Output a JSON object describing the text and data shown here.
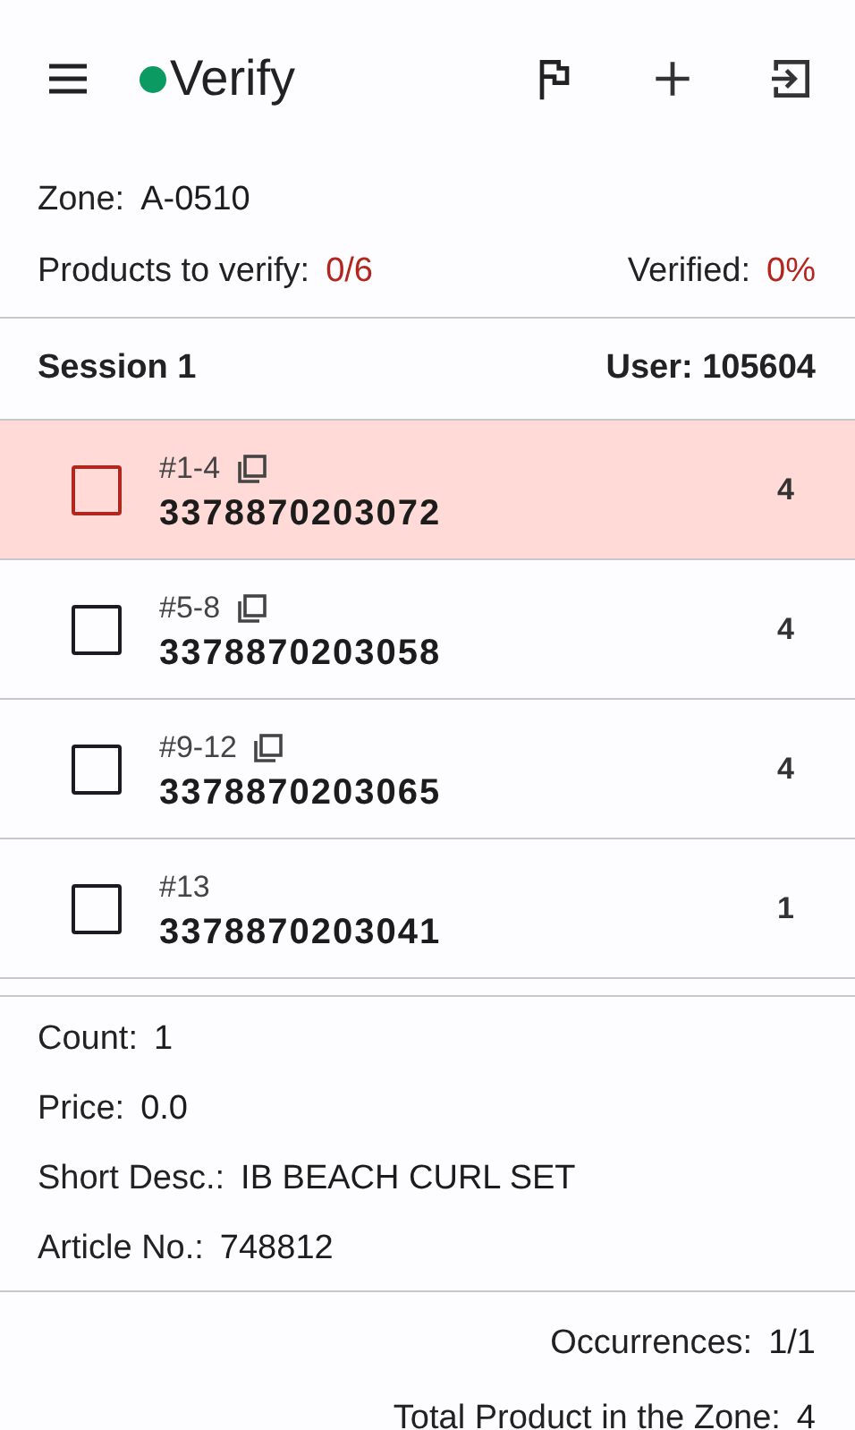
{
  "app_bar": {
    "title": "Verify",
    "connected": true
  },
  "summary": {
    "zone_label": "Zone:",
    "zone": "A-0510",
    "products_label": "Products to verify:",
    "products": "0/6",
    "verified_label": "Verified:",
    "verified": "0%"
  },
  "session": {
    "name": "Session 1",
    "user": "User: 105604"
  },
  "items": [
    {
      "range": "#1-4",
      "copyable": true,
      "barcode": "3378870203072",
      "quantity": "4",
      "selected": true,
      "checked": false
    },
    {
      "range": "#5-8",
      "copyable": true,
      "barcode": "3378870203058",
      "quantity": "4",
      "selected": false,
      "checked": false
    },
    {
      "range": "#9-12",
      "copyable": true,
      "barcode": "3378870203065",
      "quantity": "4",
      "selected": false,
      "checked": false
    },
    {
      "range": "#13",
      "copyable": false,
      "barcode": "3378870203041",
      "quantity": "1",
      "selected": false,
      "checked": false
    }
  ],
  "details": [
    {
      "label": "Count:",
      "value": "1"
    },
    {
      "label": "Price:",
      "value": "0.0"
    },
    {
      "label": "Short Desc.:",
      "value": "IB BEACH CURL SET"
    },
    {
      "label": "Article No.:",
      "value": "748812"
    }
  ],
  "footer": [
    {
      "label": "Occurrences:",
      "value": "1/1"
    },
    {
      "label": "Total Product in the Zone:",
      "value": "4"
    }
  ]
}
